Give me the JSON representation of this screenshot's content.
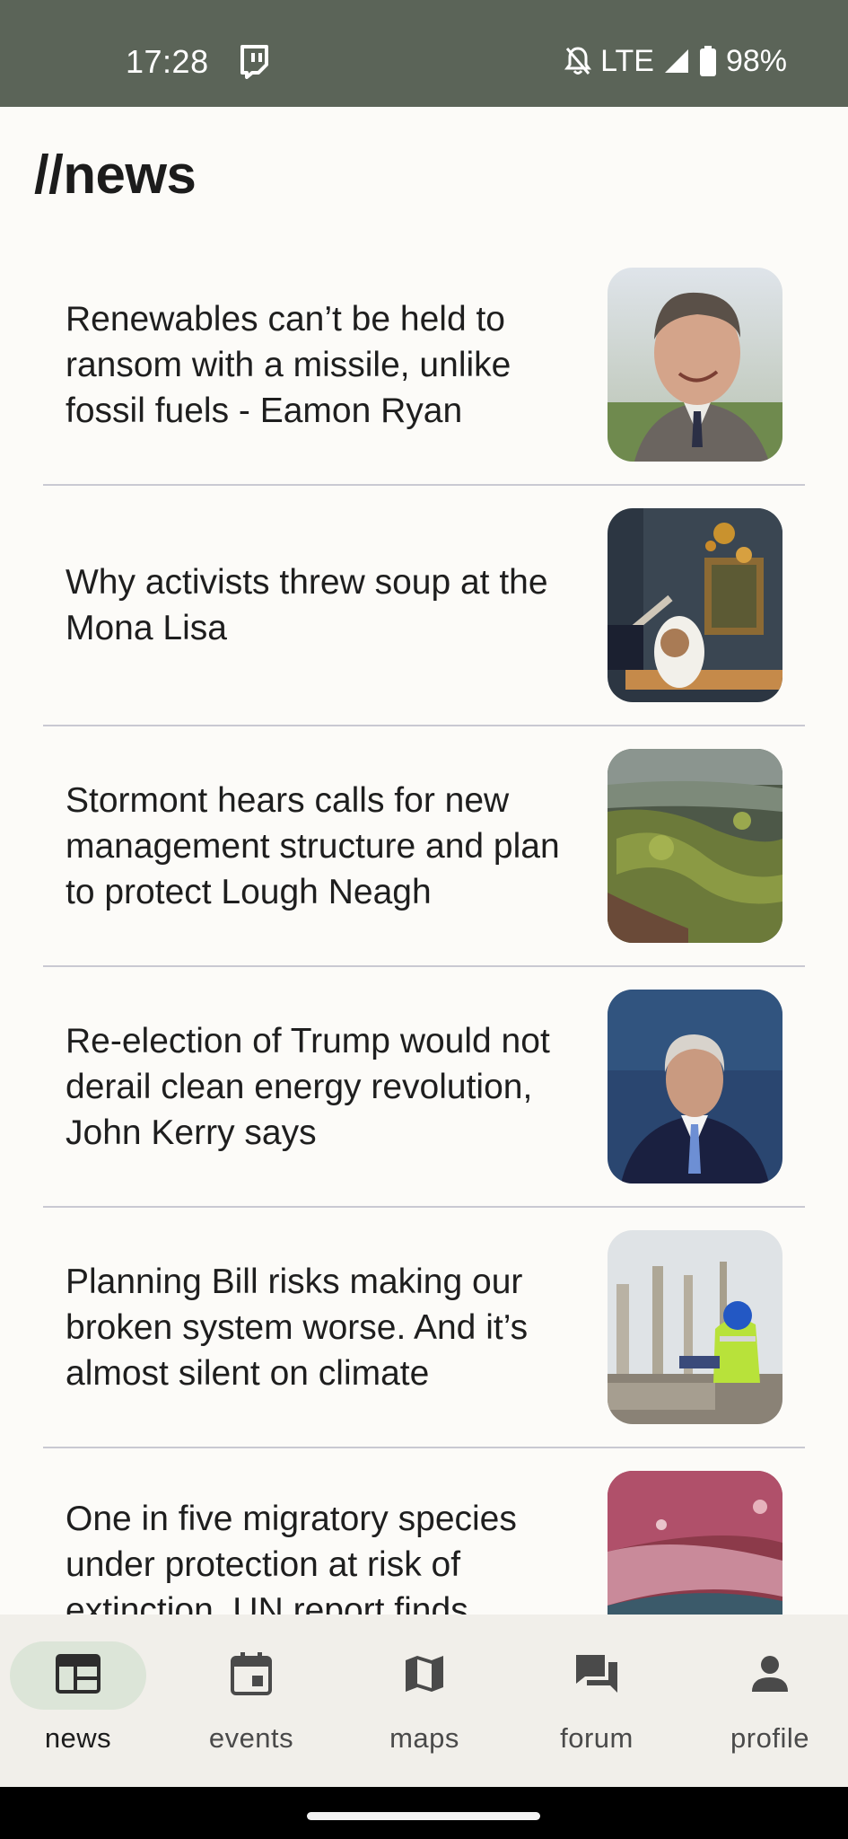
{
  "status_bar": {
    "time": "17:28",
    "network": "LTE",
    "battery": "98%",
    "icons": [
      "twitch-icon",
      "bell-off-icon",
      "signal-icon",
      "battery-icon"
    ]
  },
  "page": {
    "title": "//news"
  },
  "articles": [
    {
      "title": "Renewables can’t be held to ransom with a missile, unlike fossil fuels - Eamon Ryan",
      "thumb": "portrait-man-grey-hair"
    },
    {
      "title": "Why activists threw soup at the Mona Lisa",
      "thumb": "soup-on-painting"
    },
    {
      "title": "Stormont hears calls for new management structure and plan to protect Lough Neagh",
      "thumb": "algae-lake"
    },
    {
      "title": "Re-election of Trump would not derail clean energy revolution, John Kerry says",
      "thumb": "man-in-suit-blue-background"
    },
    {
      "title": "Planning Bill risks making our broken system worse. And it’s almost silent on climate",
      "thumb": "construction-worker"
    },
    {
      "title": "One in five migratory species under protection at risk of extinction, UN report finds",
      "thumb": "pink-birds-water"
    }
  ],
  "bottom_nav": {
    "items": [
      {
        "label": "news",
        "icon": "newspaper-icon",
        "active": true
      },
      {
        "label": "events",
        "icon": "calendar-icon",
        "active": false
      },
      {
        "label": "maps",
        "icon": "map-icon",
        "active": false
      },
      {
        "label": "forum",
        "icon": "forum-icon",
        "active": false
      },
      {
        "label": "profile",
        "icon": "person-icon",
        "active": false
      }
    ]
  },
  "colors": {
    "status_bar": "#5b6458",
    "background": "#fcfbf8",
    "nav_background": "#f1efea",
    "active_pill": "#dce5d8",
    "divider": "#c9c9d2"
  }
}
